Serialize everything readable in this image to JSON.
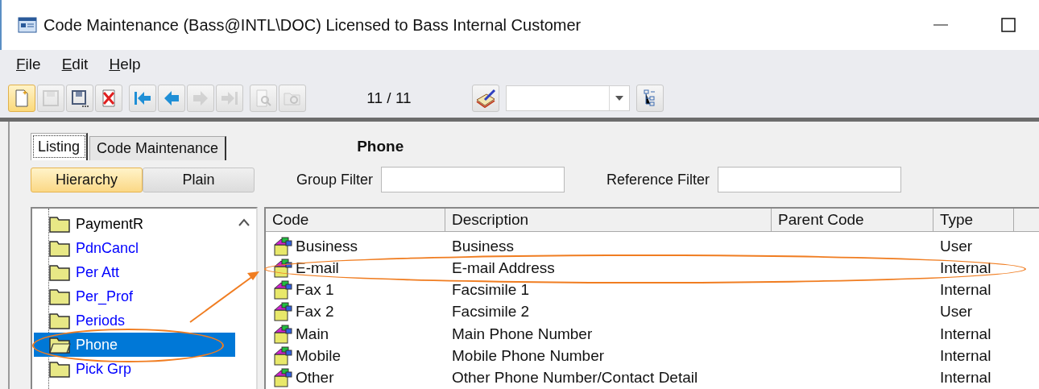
{
  "window": {
    "title": "Code Maintenance (Bass@INTL\\DOC) Licensed to Bass Internal Customer"
  },
  "menu": [
    {
      "label": "File"
    },
    {
      "label": "Edit"
    },
    {
      "label": "Help"
    }
  ],
  "toolbar": {
    "groups": [
      [
        {
          "kind": "new",
          "disabled": false,
          "selected": true
        },
        {
          "kind": "save",
          "disabled": true,
          "selected": false
        },
        {
          "kind": "save-as",
          "disabled": false,
          "selected": false
        },
        {
          "kind": "delete",
          "disabled": false,
          "selected": false
        }
      ],
      [
        {
          "kind": "first",
          "disabled": false,
          "selected": false
        },
        {
          "kind": "prev",
          "disabled": false,
          "selected": false
        },
        {
          "kind": "next",
          "disabled": true,
          "selected": false
        },
        {
          "kind": "last",
          "disabled": true,
          "selected": false
        }
      ],
      [
        {
          "kind": "find",
          "disabled": true,
          "selected": false
        },
        {
          "kind": "find-folder",
          "disabled": true,
          "selected": false
        }
      ]
    ],
    "counter": "11 / 11"
  },
  "tabs": [
    {
      "label": "Listing",
      "selected": true
    },
    {
      "label": "Code Maintenance",
      "selected": false
    }
  ],
  "heading": "Phone",
  "view_toggle": [
    {
      "label": "Hierarchy",
      "selected": true
    },
    {
      "label": "Plain",
      "selected": false
    }
  ],
  "filters": [
    {
      "label": "Group Filter"
    },
    {
      "label": "Reference Filter"
    }
  ],
  "tree": [
    {
      "label": "PaymentR",
      "color": "#000000",
      "selected": false,
      "circled": false
    },
    {
      "label": "PdnCancl",
      "color": "#0000ff",
      "selected": false,
      "circled": false
    },
    {
      "label": "Per Att",
      "color": "#0000ff",
      "selected": false,
      "circled": false
    },
    {
      "label": "Per_Prof",
      "color": "#0000ff",
      "selected": false,
      "circled": false
    },
    {
      "label": "Periods",
      "color": "#0000ff",
      "selected": false,
      "circled": false
    },
    {
      "label": "Phone",
      "selected": true,
      "circled": true
    },
    {
      "label": "Pick Grp",
      "color": "#0000ff",
      "selected": false,
      "circled": false
    }
  ],
  "table": {
    "columns": [
      "Code",
      "Description",
      "Parent Code",
      "Type"
    ],
    "rows": [
      {
        "code": "Business",
        "description": "Business",
        "type": "User",
        "circled": false
      },
      {
        "code": "E-mail",
        "description": "E-mail Address",
        "type": "Internal",
        "circled": true
      },
      {
        "code": "Fax 1",
        "description": "Facsimile 1",
        "type": "Internal",
        "circled": false
      },
      {
        "code": "Fax 2",
        "description": "Facsimile 2",
        "type": "User",
        "circled": false
      },
      {
        "code": "Main",
        "description": "Main Phone Number",
        "type": "Internal",
        "circled": false
      },
      {
        "code": "Mobile",
        "description": "Mobile Phone Number",
        "type": "Internal",
        "circled": false
      },
      {
        "code": "Other",
        "description": "Other Phone Number/Contact Detail",
        "type": "Internal",
        "circled": false
      }
    ]
  }
}
